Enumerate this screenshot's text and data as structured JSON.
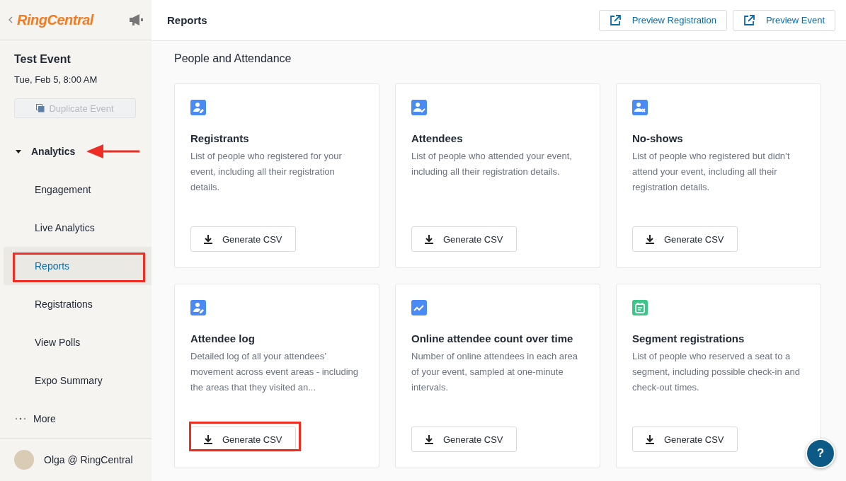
{
  "sidebar": {
    "logo": "RingCentral",
    "event_title": "Test Event",
    "event_date": "Tue, Feb 5, 8:00 AM",
    "duplicate_button": {
      "label": "Duplicate Event",
      "disabled": true
    },
    "section": {
      "label": "Analytics",
      "expanded": true,
      "annotated": true
    },
    "items": [
      {
        "label": "Engagement",
        "selected": false,
        "annotated": false
      },
      {
        "label": "Live Analytics",
        "selected": false,
        "annotated": false
      },
      {
        "label": "Reports",
        "selected": true,
        "annotated": true
      },
      {
        "label": "Registrations",
        "selected": false,
        "annotated": false
      },
      {
        "label": "View Polls",
        "selected": false,
        "annotated": false
      },
      {
        "label": "Expo Summary",
        "selected": false,
        "annotated": false
      }
    ],
    "more": "More",
    "user": "Olga @ RingCentral"
  },
  "header": {
    "title": "Reports",
    "buttons": [
      "Preview Registration",
      "Preview Event"
    ]
  },
  "section_title": "People and Attendance",
  "cards": [
    {
      "kind": "person-edit",
      "color": "#4a8af4",
      "title": "Registrants",
      "description": "List of people who registered for your event, including all their registration details.",
      "button": "Generate CSV",
      "annotated": false
    },
    {
      "kind": "person-check",
      "color": "#4a8af4",
      "title": "Attendees",
      "description": "List of people who attended your event, including all their registration details.",
      "button": "Generate CSV",
      "annotated": false
    },
    {
      "kind": "person-x",
      "color": "#4a8af4",
      "title": "No-shows",
      "description": "List of people who registered but didn’t attend your event, including all their registration details.",
      "button": "Generate CSV",
      "annotated": false
    },
    {
      "kind": "person-edit",
      "color": "#4a8af4",
      "title": "Attendee log",
      "description": "Detailed log of all your attendees’ movement across event areas - including the areas that they visited an...",
      "button": "Generate CSV",
      "annotated": true
    },
    {
      "kind": "chart",
      "color": "#4a8af4",
      "title": "Online attendee count over time",
      "description": "Number of online attendees in each area of your event, sampled at one-minute intervals.",
      "button": "Generate CSV",
      "annotated": false
    },
    {
      "kind": "calendar",
      "color": "#3cc68a",
      "title": "Segment registrations",
      "description": "List of people who reserved a seat to a segment, including possible check-in and check-out times.",
      "button": "Generate CSV",
      "annotated": false
    }
  ],
  "help_button": "?"
}
